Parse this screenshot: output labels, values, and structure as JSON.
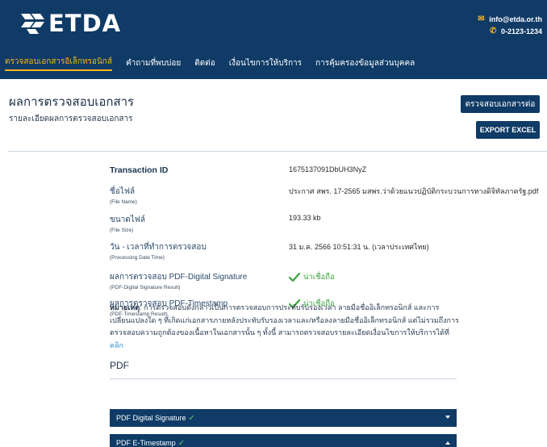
{
  "brand": {
    "name": "ETDA"
  },
  "contact": {
    "email": "info@etda.or.th",
    "phone": "0-2123-1234"
  },
  "nav": [
    "ตรวจสอบเอกสารอิเล็กทรอนิกส์",
    "คำถามที่พบบ่อย",
    "ติดต่อ",
    "เงื่อนไขการให้บริการ",
    "การคุ้มครองข้อมูลส่วนบุคคล"
  ],
  "page": {
    "title": "ผลการตรวจสอบเอกสาร",
    "subtitle": "รายละเอียดผลการตรวจสอบเอกสาร",
    "check_button": "ตรวจสอบเอกสารต่อ",
    "export_button": "EXPORT EXCEL"
  },
  "details": {
    "transaction": {
      "label": "Transaction ID",
      "value": "1675137091DbUH3NyZ"
    },
    "file_name": {
      "label": "ชื่อไฟล์",
      "sub": "(File Name)",
      "value": "ประกาศ สพร. 17-2565 มสพร.ว่าด้วยแนวปฏิบัติกระบวนการทางดิจิทัลภาครัฐ.pdf"
    },
    "file_size": {
      "label": "ขนาดไฟล์",
      "sub": "(File Size)",
      "value": "193.33 kb"
    },
    "processing_time": {
      "label": "วัน - เวลาที่ทำการตรวจสอบ",
      "sub": "(Processing Date Time)",
      "value": "31 ม.ค. 2566 10:51:31 น. (เวลาประเทศไทย)"
    },
    "signature": {
      "label": "ผลการตรวจสอบ PDF-Digital Signature",
      "sub": "(PDF-Digital Signature Result)",
      "value": "น่าเชื่อถือ"
    },
    "timestamp": {
      "label": "ผลการตรวจสอบ PDF-Timestamp",
      "sub": "(PDF-Timestamp Result)",
      "value": "น่าเชื่อถือ"
    }
  },
  "note": {
    "heading": "หมายเหตุ",
    "text": ": การตรวจสอบดังกล่าวเป็นการตรวจสอบการประทับรับรองเวลา ลายมือชื่ออิเล็กทรอนิกส์ และการเปลี่ยนแปลงใด ๆ ที่เกิดแก่เอกสารภายหลังประทับรับรองเวลาและ/หรือลงลายมือชื่ออิเล็กทรอนิกส์ แต่ไม่รวมถึงการตรวจสอบความถูกต้องของเนื้อหาในเอกสารนั้น ๆ ทั้งนี้ สามารถตรวจสอบรายละเอียดเงื่อนไขการให้บริการได้ที่",
    "link": "คลิก"
  },
  "pdf": {
    "title": "PDF",
    "sections": [
      "PDF Digital Signature",
      "PDF E-Timestamp"
    ]
  },
  "colors": {
    "primary": "#0f3b66",
    "accent": "#f6b21b",
    "valid": "#3da33f",
    "link": "#2f8fd8"
  }
}
